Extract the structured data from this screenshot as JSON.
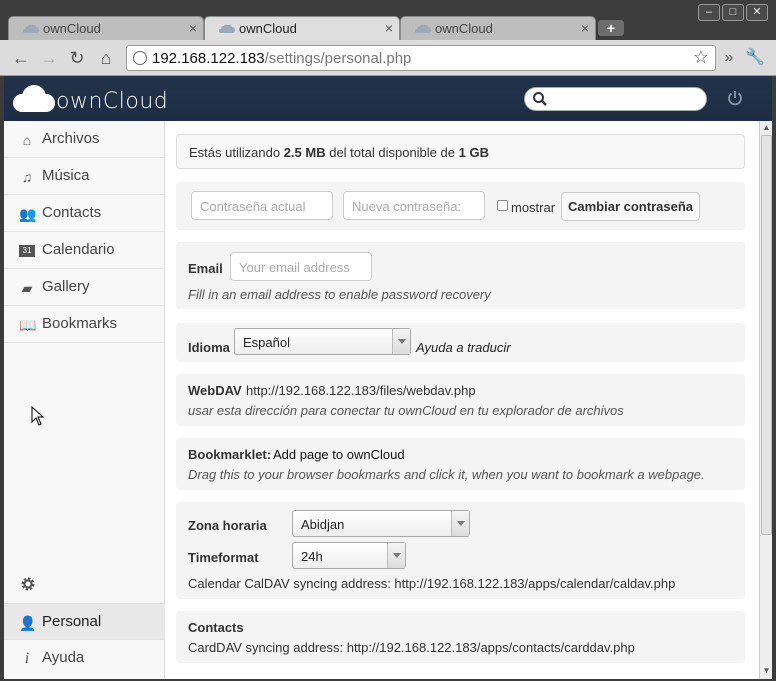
{
  "browser": {
    "tabs": [
      {
        "title": "ownCloud",
        "active": false
      },
      {
        "title": "ownCloud",
        "active": true
      },
      {
        "title": "ownCloud",
        "active": false
      }
    ],
    "url_host": "192.168.122.183",
    "url_path": "/settings/personal.php"
  },
  "header": {
    "logo_text": "ownCloud"
  },
  "sidebar": {
    "items": [
      {
        "label": "Archivos",
        "icon": "folder-icon"
      },
      {
        "label": "Música",
        "icon": "music-icon"
      },
      {
        "label": "Contacts",
        "icon": "people-icon"
      },
      {
        "label": "Calendario",
        "icon": "calendar-icon"
      },
      {
        "label": "Gallery",
        "icon": "image-icon"
      },
      {
        "label": "Bookmarks",
        "icon": "book-icon"
      }
    ],
    "bottom": [
      {
        "label": "Personal",
        "icon": "person-icon",
        "active": true
      },
      {
        "label": "Ayuda",
        "icon": "info-icon"
      }
    ]
  },
  "usage": {
    "prefix": "Estás utilizando",
    "used": "2.5 MB",
    "middle": "del total disponible de",
    "total": "1 GB"
  },
  "password": {
    "current_placeholder": "Contraseña actual",
    "new_placeholder": "Nueva contraseña:",
    "show_label": "mostrar",
    "change_button": "Cambiar contraseña"
  },
  "email": {
    "label": "Email",
    "placeholder": "Your email address",
    "hint": "Fill in an email address to enable password recovery"
  },
  "language": {
    "label": "Idioma",
    "selected": "Español",
    "help_link": "Ayuda a traducir"
  },
  "webdav": {
    "label": "WebDAV",
    "url": "http://192.168.122.183/files/webdav.php",
    "hint": "usar esta dirección para conectar tu ownCloud en tu explorador de archivos"
  },
  "bookmarklet": {
    "label": "Bookmarklet:",
    "link": "Add page to ownCloud",
    "hint": "Drag this to your browser bookmarks and click it, when you want to bookmark a webpage."
  },
  "calendar": {
    "timezone_label": "Zona horaria",
    "timezone_value": "Abidjan",
    "timeformat_label": "Timeformat",
    "timeformat_value": "24h",
    "caldav_text": "Calendar CalDAV syncing address: http://192.168.122.183/apps/calendar/caldav.php"
  },
  "contacts": {
    "label": "Contacts",
    "carddav_text": "CardDAV syncing address: http://192.168.122.183/apps/contacts/carddav.php"
  }
}
